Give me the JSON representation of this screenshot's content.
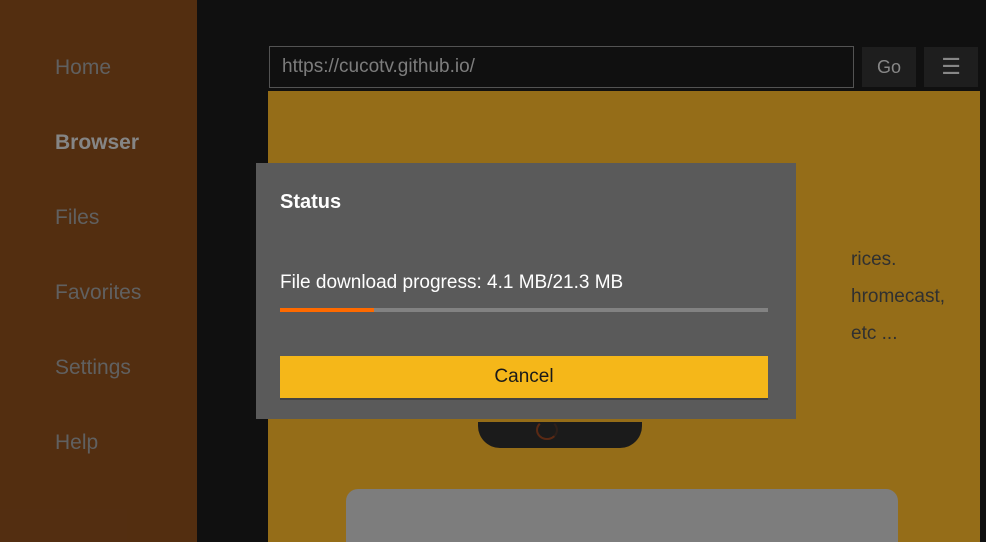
{
  "sidebar": {
    "items": [
      {
        "label": "Home"
      },
      {
        "label": "Browser"
      },
      {
        "label": "Files"
      },
      {
        "label": "Favorites"
      },
      {
        "label": "Settings"
      },
      {
        "label": "Help"
      }
    ],
    "active_index": 1
  },
  "url_bar": {
    "value": "https://cucotv.github.io/",
    "go_label": "Go"
  },
  "background_text": {
    "line1": "rices.",
    "line2": "hromecast,",
    "line3": "etc ..."
  },
  "dialog": {
    "title": "Status",
    "message": "File download progress: 4.1 MB/21.3 MB",
    "downloaded_mb": 4.1,
    "total_mb": 21.3,
    "progress_percent": 19.2,
    "cancel_label": "Cancel"
  }
}
